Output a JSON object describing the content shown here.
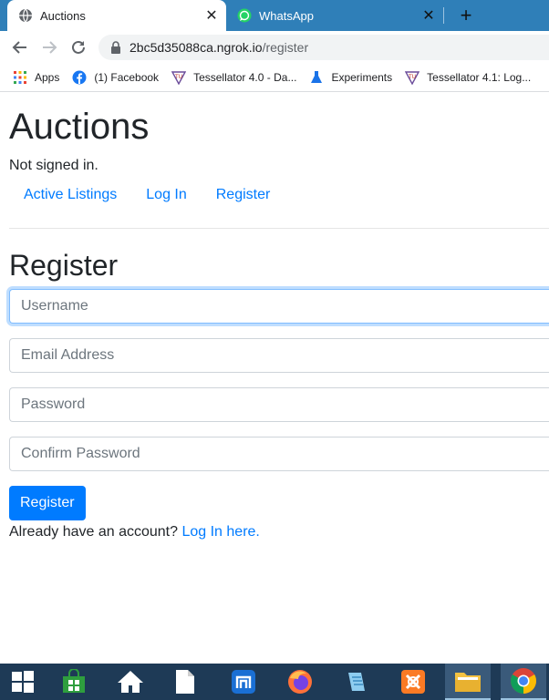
{
  "browser": {
    "tabs": [
      {
        "title": "Auctions",
        "icon": "globe-icon",
        "active": true
      },
      {
        "title": "WhatsApp",
        "icon": "whatsapp-icon",
        "active": false
      }
    ],
    "url_host": "2bc5d35088ca.ngrok.io",
    "url_path": "/register",
    "bookmarks": [
      {
        "label": "Apps",
        "icon": "apps-grid-icon"
      },
      {
        "label": "(1) Facebook",
        "icon": "facebook-icon"
      },
      {
        "label": "Tessellator 4.0 - Da...",
        "icon": "tessellator-icon"
      },
      {
        "label": "Experiments",
        "icon": "flask-icon"
      },
      {
        "label": "Tessellator 4.1: Log...",
        "icon": "tessellator-icon"
      }
    ]
  },
  "page": {
    "site_title": "Auctions",
    "status": "Not signed in.",
    "nav": [
      "Active Listings",
      "Log In",
      "Register"
    ],
    "heading": "Register",
    "fields": {
      "username_placeholder": "Username",
      "email_placeholder": "Email Address",
      "password_placeholder": "Password",
      "confirm_placeholder": "Confirm Password"
    },
    "submit_label": "Register",
    "account_prompt": "Already have an account?",
    "login_link": "Log In here."
  },
  "taskbar": {
    "items": [
      "windows-start-icon",
      "store-icon",
      "home-icon",
      "document-icon",
      "maxthon-icon",
      "firefox-icon",
      "notepad-icon",
      "xampp-icon",
      "file-explorer-icon",
      "chrome-icon"
    ]
  },
  "colors": {
    "tabstrip": "#2f7fb8",
    "link": "#007bff",
    "button": "#007bff",
    "taskbar": "#1e3a56"
  }
}
